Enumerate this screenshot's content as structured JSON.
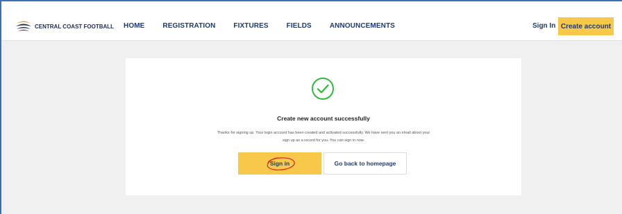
{
  "brand": {
    "name": "CENTRAL COAST FOOTBALL",
    "colors": {
      "navy": "#1c2c5a",
      "blue": "#1c3a78",
      "yellow": "#f8c84a",
      "orange": "#e98b1a",
      "success": "#2dbb3a"
    }
  },
  "nav": {
    "items": [
      {
        "label": "HOME"
      },
      {
        "label": "REGISTRATION"
      },
      {
        "label": "FIXTURES"
      },
      {
        "label": "FIELDS"
      },
      {
        "label": "ANNOUNCEMENTS"
      }
    ],
    "sign_in": "Sign In",
    "create_account": "Create account"
  },
  "main": {
    "icon": "check-circle-icon",
    "title": "Create new account successfully",
    "desc_line1": "Thanks for signing up. Your login account has been created and activated successfully. We have sent you an email about your",
    "desc_line2": "sign up as a record for you. You can sign in now.",
    "sign_in_button": "Sign in",
    "home_button": "Go back to homepage"
  }
}
